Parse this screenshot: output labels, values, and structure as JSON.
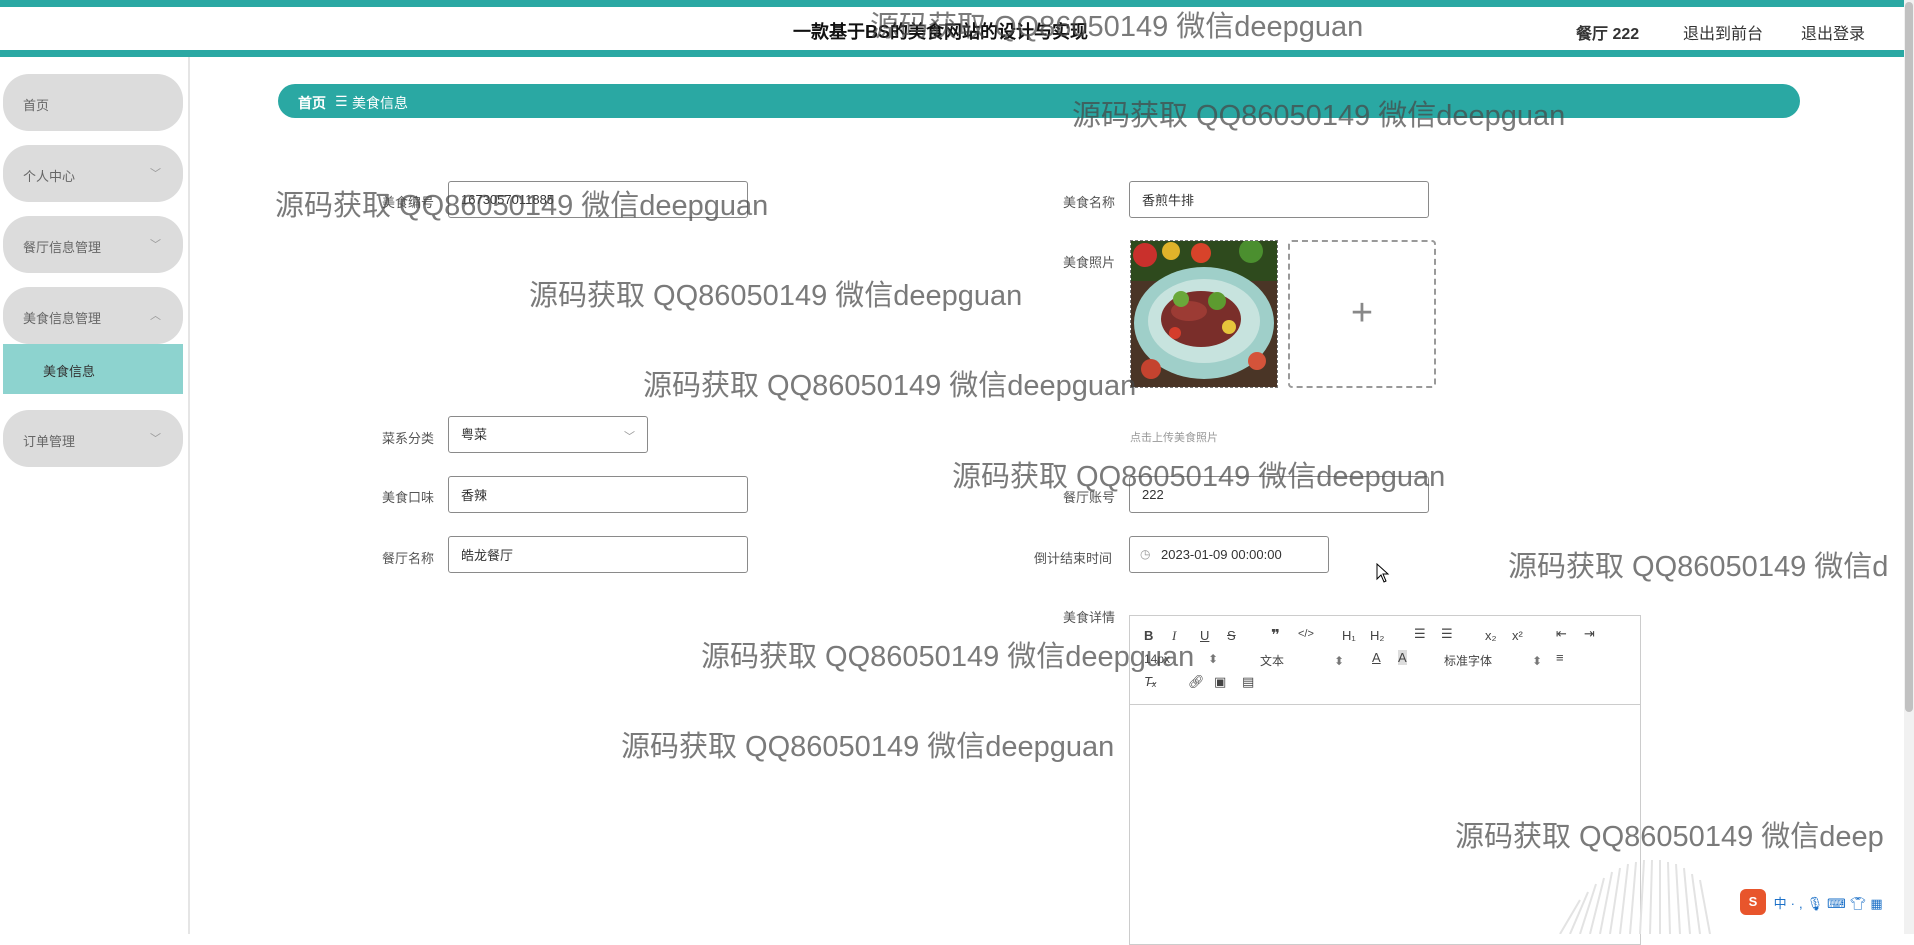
{
  "header": {
    "title": "一款基于BS的美食网站的设计与实现",
    "user": "餐厅 222",
    "link_front": "退出到前台",
    "link_logout": "退出登录"
  },
  "sidebar": {
    "items": [
      {
        "label": "首页"
      },
      {
        "label": "个人中心"
      },
      {
        "label": "餐厅信息管理"
      },
      {
        "label": "美食信息管理"
      },
      {
        "label": "订单管理"
      }
    ],
    "sub_item": "美食信息"
  },
  "breadcrumb": {
    "home": "首页",
    "separator": "☰",
    "current": "美食信息"
  },
  "form": {
    "food_no_label": "美食编号",
    "food_no_value": "1673057011885",
    "food_name_label": "美食名称",
    "food_name_value": "香煎牛排",
    "photo_label": "美食照片",
    "photo_hint": "点击上传美食照片",
    "cuisine_label": "菜系分类",
    "cuisine_value": "粤菜",
    "taste_label": "美食口味",
    "taste_value": "香辣",
    "account_label": "餐厅账号",
    "account_value": "222",
    "restaurant_label": "餐厅名称",
    "restaurant_value": "皓龙餐厅",
    "countdown_label": "倒计结束时间",
    "countdown_value": "2023-01-09 00:00:00",
    "detail_label": "美食详情"
  },
  "editor": {
    "font_size": "14px",
    "heading_select": "文本",
    "font_family": "标准字体"
  },
  "watermark": {
    "text": "源码获取 QQ86050149 微信deepguan",
    "text_cut1": "源码获取 QQ86050149 微信d",
    "text_cut2": "源码获取 QQ86050149 微信deep"
  },
  "ime": {
    "logo": "S",
    "lang": "中"
  },
  "colors": {
    "accent": "#2aa8a3",
    "submenu_active": "#8dd3cf",
    "menu_bg": "#dcdcdc"
  }
}
